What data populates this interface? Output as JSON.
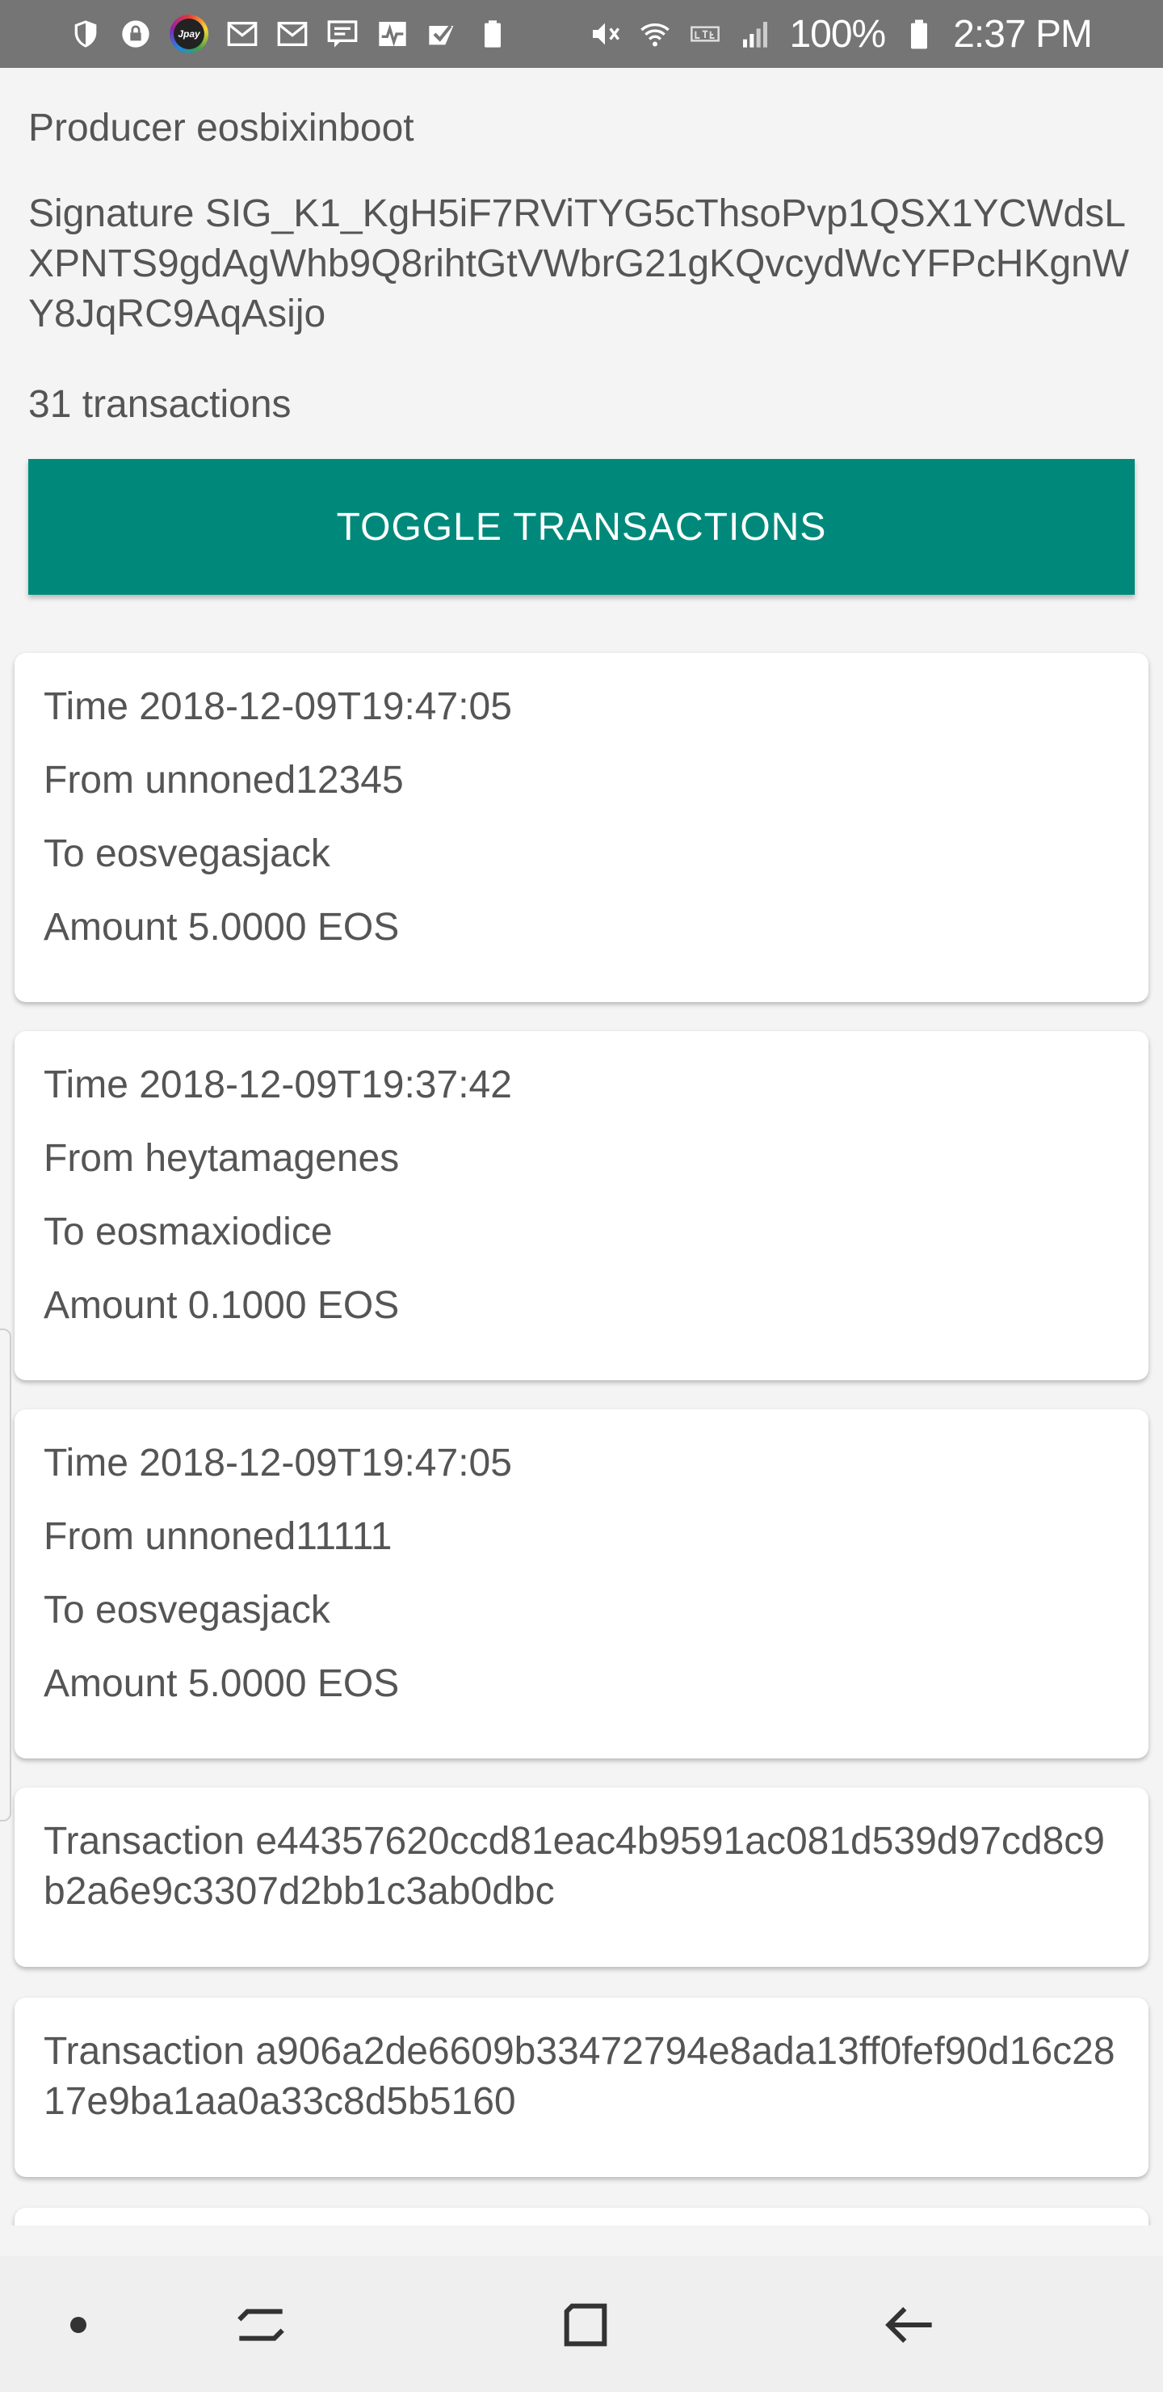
{
  "status_bar": {
    "battery": "100%",
    "time": "2:37 PM",
    "jpay_label": "Jpay",
    "left_icons": [
      "shield-icon",
      "lock-icon",
      "jpay-icon",
      "gmail-icon",
      "gmail-icon",
      "message-icon",
      "activity-icon",
      "check-icon",
      "battery-100-icon"
    ],
    "right_icons": [
      "mute-icon",
      "wifi-icon",
      "lte-icon",
      "signal-icon",
      "battery-icon"
    ]
  },
  "block": {
    "producer": "Producer eosbixinboot",
    "signature": "Signature SIG_K1_KgH5iF7RViTYG5cThsoPvp1QSX1YCWdsLXPNTS9gdAgWhb9Q8rihtGtVWbrG21gKQvcydWcYFPcHKgnWY8JqRC9AqAsijo",
    "transaction_count": "31 transactions"
  },
  "toggle_button": {
    "label": "TOGGLE TRANSACTIONS"
  },
  "transfers": [
    {
      "time": "Time 2018-12-09T19:47:05",
      "from": "From unnoned12345",
      "to": "To eosvegasjack",
      "amount": "Amount 5.0000 EOS"
    },
    {
      "time": "Time 2018-12-09T19:37:42",
      "from": "From heytamagenes",
      "to": "To eosmaxiodice",
      "amount": "Amount 0.1000 EOS"
    },
    {
      "time": "Time 2018-12-09T19:47:05",
      "from": "From unnoned11111",
      "to": "To eosvegasjack",
      "amount": "Amount 5.0000 EOS"
    }
  ],
  "transactions": [
    {
      "label": "Transaction e44357620ccd81eac4b9591ac081d539d97cd8c9b2a6e9c3307d2bb1c3ab0dbc"
    },
    {
      "label": "Transaction a906a2de6609b33472794e8ada13ff0fef90d16c2817e9ba1aa0a33c8d5b5160"
    }
  ],
  "nav_bar": {
    "icons": [
      "dot-icon",
      "recent-apps-icon",
      "home-icon",
      "back-icon"
    ]
  },
  "colors": {
    "accent": "#00897b",
    "status_bar": "#757575",
    "background": "#f4f4f4",
    "text": "#555555"
  }
}
